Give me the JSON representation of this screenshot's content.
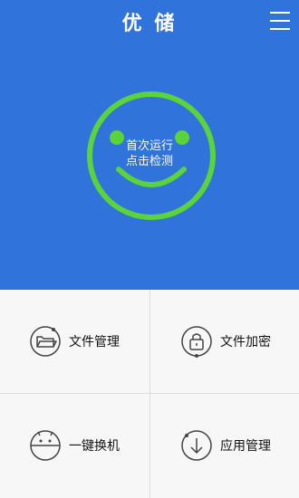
{
  "header": {
    "title": "优 储",
    "menu_icon": "menu-icon"
  },
  "hero": {
    "background": "#2f73db",
    "face_color": "#5bd33a",
    "status_line1": "首次运行",
    "status_line2": "点击检测"
  },
  "features": [
    {
      "label": "文件管理",
      "icon": "folder-icon"
    },
    {
      "label": "文件加密",
      "icon": "lock-icon"
    },
    {
      "label": "一键换机",
      "icon": "android-icon"
    },
    {
      "label": "应用管理",
      "icon": "download-icon"
    }
  ]
}
